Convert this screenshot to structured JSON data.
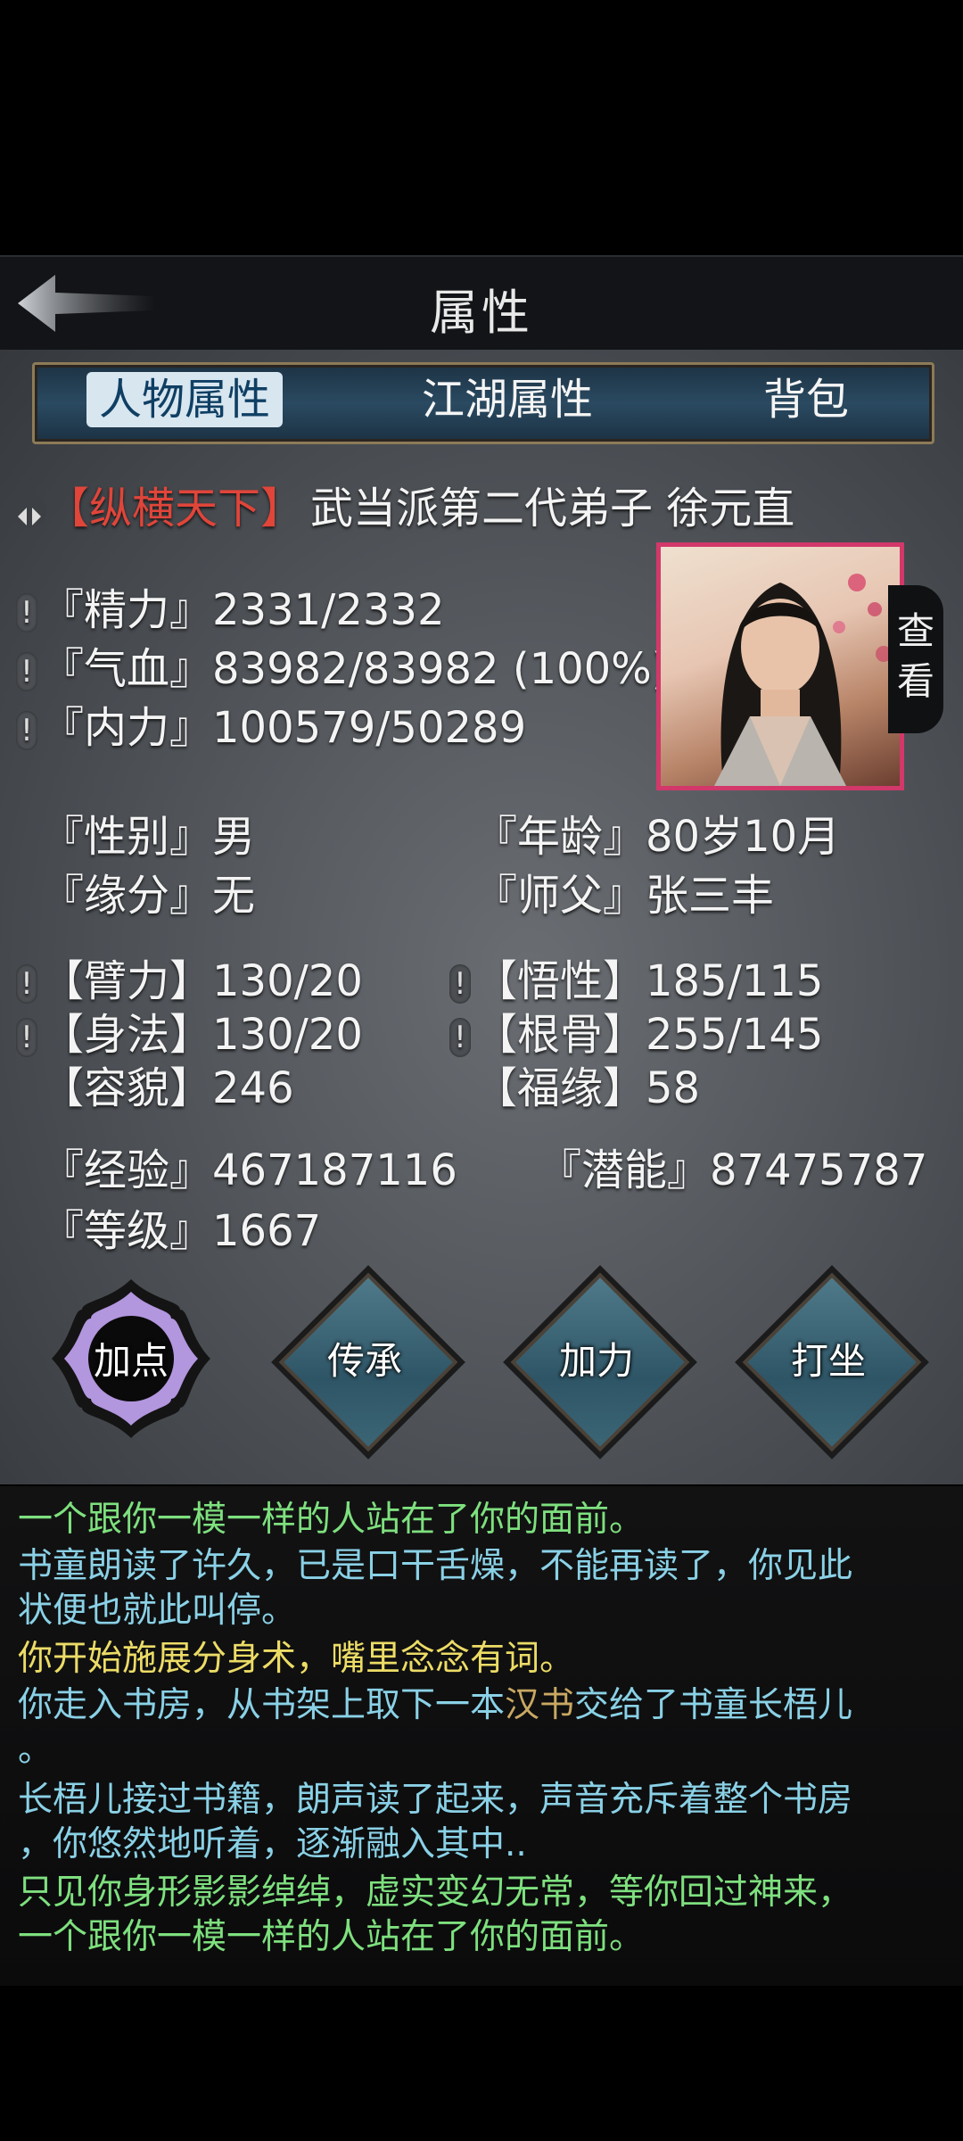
{
  "header": {
    "title": "属性"
  },
  "tabs": [
    "人物属性",
    "江湖属性",
    "背包"
  ],
  "character": {
    "title_tag": "【纵横天下】",
    "description": "武当派第二代弟子 徐元直",
    "view_button": "查看"
  },
  "vitals": [
    {
      "label": "『精力』",
      "value": "2331/2332"
    },
    {
      "label": "『气血』",
      "value": "83982/83982 (100%)"
    },
    {
      "label": "『内力』",
      "value": "100579/50289"
    }
  ],
  "info": {
    "gender_label": "『性别』",
    "gender": "男",
    "age_label": "『年龄』",
    "age": "80岁10月",
    "fate_label": "『缘分』",
    "fate": "无",
    "master_label": "『师父』",
    "master": "张三丰"
  },
  "stats": {
    "arm_label": "【臂力】",
    "arm": "130/20",
    "wisdom_label": "【悟性】",
    "wisdom": "185/115",
    "agility_label": "【身法】",
    "agility": "130/20",
    "bone_label": "【根骨】",
    "bone": "255/145",
    "looks_label": "【容貌】",
    "looks": "246",
    "luck_label": "【福缘】",
    "luck": "58"
  },
  "progress": {
    "exp_label": "『经验』",
    "exp": "467187116",
    "potential_label": "『潜能』",
    "potential": "87475787",
    "level_label": "『等级』",
    "level": "1667"
  },
  "actions": [
    "加点",
    "传承",
    "加力",
    "打坐"
  ],
  "log": {
    "line1": "一个跟你一模一样的人站在了你的面前。",
    "line2": "书童朗读了许久，已是口干舌燥，不能再读了，你见此",
    "line3": "状便也就此叫停。",
    "line4": "你开始施展分身术，嘴里念念有词。",
    "line5a": "你走入书房，从书架上取下一本",
    "line5b": "汉书",
    "line5c": "交给了书童长梧儿",
    "line6": "。",
    "line7": "长梧儿接过书籍，朗声读了起来，声音充斥着整个书房",
    "line8": "，你悠然地听着，逐渐融入其中..",
    "line9": "只见你身形影影绰绰，虚实变幻无常，等你回过神来，",
    "line10": "一个跟你一模一样的人站在了你的面前。"
  },
  "colors": {
    "log_green": "#7ee07e",
    "log_blue": "#8ad1e6",
    "log_yellow": "#ecdc66",
    "title_red": "#e0453a",
    "portrait_border": "#d2386a"
  }
}
